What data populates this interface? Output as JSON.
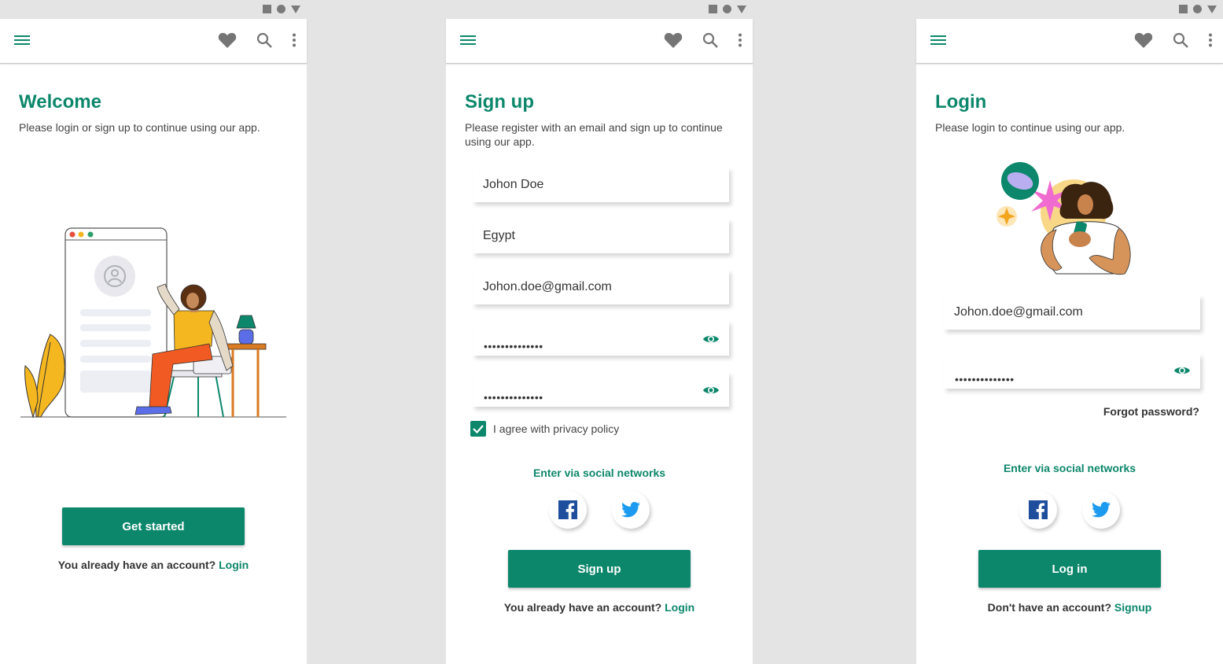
{
  "colors": {
    "accent": "#0c876b",
    "background": "#e4e4e4",
    "surface": "#ffffff"
  },
  "icons": {
    "menu": "hamburger-menu-icon",
    "favorite": "heart-icon",
    "search": "search-icon",
    "more": "more-vert-icon",
    "password_toggle": "eye-icon"
  },
  "welcome": {
    "title": "Welcome",
    "subtitle": "Please login or sign up to continue using our app.",
    "cta": "Get started",
    "account_prompt": "You already have an account?",
    "account_link": "Login"
  },
  "signup": {
    "title": "Sign up",
    "subtitle": "Please register with an email and sign up to continue using our app.",
    "name_value": "Johon Doe",
    "country_value": "Egypt",
    "email_value": "Johon.doe@gmail.com",
    "password_mask": "••••••••••••••",
    "confirm_mask": "••••••••••••••",
    "privacy_checked": true,
    "privacy_label": "I agree with privacy policy",
    "social_title": "Enter via social networks",
    "submit": "Sign up",
    "account_prompt": "You already have an account?",
    "account_link": "Login"
  },
  "login": {
    "title": "Login",
    "subtitle": "Please login to continue using our app.",
    "email_value": "Johon.doe@gmail.com",
    "password_mask": "••••••••••••••",
    "forgot": "Forgot password?",
    "social_title": "Enter via social networks",
    "submit": "Log in",
    "account_prompt": "Don't have an account?",
    "account_link": "Signup"
  }
}
